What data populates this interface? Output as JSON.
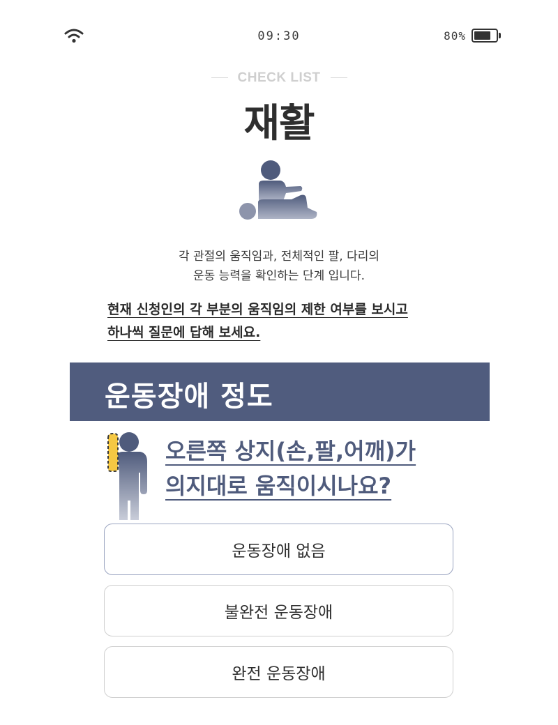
{
  "status_bar": {
    "time": "09:30",
    "battery_percent": "80%",
    "battery_level": 0.8,
    "icons": [
      "wifi-icon",
      "battery-icon"
    ]
  },
  "header": {
    "checklist_label": "CHECK LIST",
    "title": "재활"
  },
  "illustration": {
    "icon": "rehab-massage-icon"
  },
  "description": {
    "line1": "각 관절의 움직임과, 전체적인 팔, 다리의",
    "line2": "운동 능력을 확인하는 단계 입니다."
  },
  "instruction": {
    "line1": "현재 신청인의 각 부분의 움직임의 제한 여부를 보시고",
    "line2": "하나씩 질문에 답해 보세요."
  },
  "section": {
    "title": "운동장애 정도"
  },
  "question": {
    "icon": "person-right-arm-highlight-icon",
    "line1": "오른쪽 상지(손,팔,어깨)가",
    "line2": "의지대로 움직이시나요?"
  },
  "options": [
    {
      "label": "운동장애 없음",
      "selected": true
    },
    {
      "label": "불완전 운동장애",
      "selected": false
    },
    {
      "label": "완전 운동장애",
      "selected": false
    }
  ],
  "colors": {
    "primary": "#505c7e",
    "highlight": "#f5c843",
    "muted_label": "#cfcfcf"
  }
}
